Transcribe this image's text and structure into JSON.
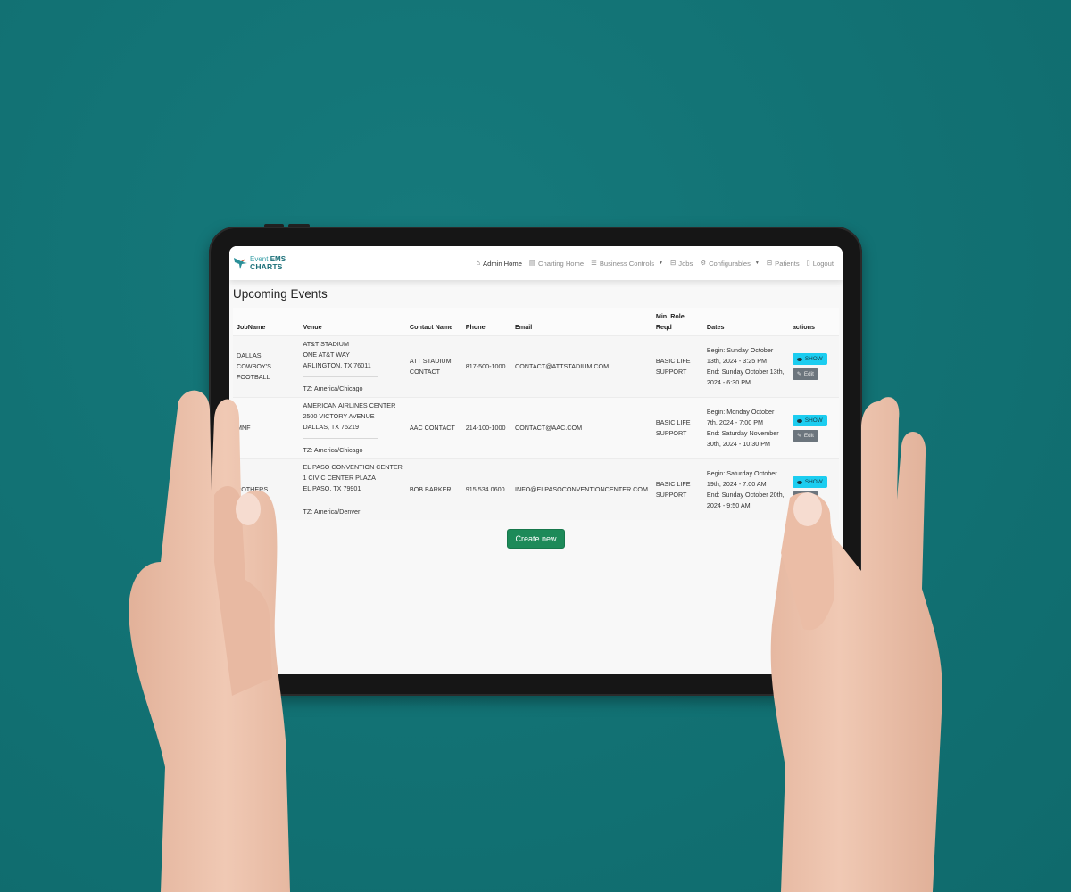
{
  "app": {
    "logo_line1_light": "Event ",
    "logo_line1_bold": "EMS",
    "logo_line2": "CHARTS"
  },
  "nav": {
    "items": [
      {
        "label": "Admin Home",
        "icon": "home-icon",
        "glyph": "⌂",
        "active": true
      },
      {
        "label": "Charting Home",
        "icon": "clipboard-icon",
        "glyph": "▤",
        "active": false
      },
      {
        "label": "Business Controls",
        "icon": "grid-icon",
        "glyph": "☷",
        "dropdown": true,
        "active": false
      },
      {
        "label": "Jobs",
        "icon": "briefcase-icon",
        "glyph": "⊟",
        "active": false
      },
      {
        "label": "Configurables",
        "icon": "gear-icon",
        "glyph": "⚙",
        "dropdown": true,
        "active": false
      },
      {
        "label": "Patients",
        "icon": "briefcase-icon",
        "glyph": "⊟",
        "active": false
      },
      {
        "label": "Logout",
        "icon": "door-icon",
        "glyph": "▯",
        "active": false
      }
    ]
  },
  "page": {
    "title": "Upcoming Events"
  },
  "table": {
    "headers": {
      "job_name": "JobName",
      "venue": "Venue",
      "contact_name": "Contact Name",
      "phone": "Phone",
      "email": "Email",
      "min_role_line1": "Min. Role",
      "min_role_line2": "Reqd",
      "dates": "Dates",
      "actions": "actions"
    },
    "rows": [
      {
        "job_name": "DALLAS COWBOY'S FOOTBALL",
        "venue_lines": [
          "AT&T STADIUM",
          "ONE AT&T WAY",
          "ARLINGTON, TX 76011"
        ],
        "timezone": "TZ: America/Chicago",
        "contact_name": "ATT STADIUM CONTACT",
        "phone": "817-500-1000",
        "email": "CONTACT@ATTSTADIUM.COM",
        "min_role": "BASIC LIFE SUPPORT",
        "begin": "Begin: Sunday October 13th, 2024 - 3:25 PM",
        "end": "End: Sunday October 13th, 2024 - 6:30 PM",
        "show_label": "SHOW",
        "edit_label": "Edit"
      },
      {
        "job_name": "MNF",
        "venue_lines": [
          "AMERICAN AIRLINES CENTER",
          "2500 VICTORY AVENUE",
          "DALLAS, TX 75219"
        ],
        "timezone": "TZ: America/Chicago",
        "contact_name": "AAC CONTACT",
        "phone": "214-100-1000",
        "email": "CONTACT@AAC.COM",
        "min_role": "BASIC LIFE SUPPORT",
        "begin": "Begin: Monday October 7th, 2024 - 7:00 PM",
        "end": "End: Saturday November 30th, 2024 - 10:30 PM",
        "show_label": "SHOW",
        "edit_label": "Edit"
      },
      {
        "job_name": "ROTHERS",
        "venue_lines": [
          "EL PASO CONVENTION CENTER",
          "1 CIVIC CENTER PLAZA",
          "EL PASO, TX 79901"
        ],
        "timezone": "TZ: America/Denver",
        "contact_name": "BOB BARKER",
        "phone": "915.534.0600",
        "email": "INFO@ELPASOCONVENTIONCENTER.COM",
        "min_role": "BASIC LIFE SUPPORT",
        "begin": "Begin: Saturday October 19th, 2024 - 7:00 AM",
        "end": "End: Sunday October 20th, 2024 - 9:50 AM",
        "show_label": "SHOW",
        "edit_label": "Edit"
      }
    ]
  },
  "footer": {
    "create_label": "Create new"
  },
  "colors": {
    "background": "#127274",
    "show_button": "#1ccdf0",
    "edit_button": "#6c757d",
    "create_button": "#1d8a59",
    "brand": "#1a6f78"
  }
}
